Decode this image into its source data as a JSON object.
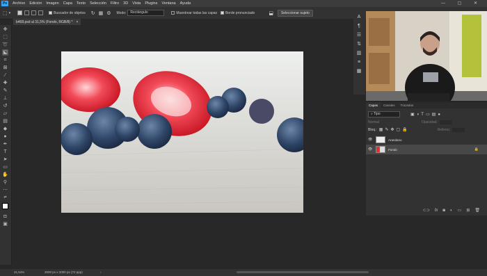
{
  "app": {
    "logo": "Ps"
  },
  "menu": [
    "Archivo",
    "Edición",
    "Imagen",
    "Capa",
    "Texto",
    "Selección",
    "Filtro",
    "3D",
    "Vista",
    "Plugins",
    "Ventana",
    "Ayuda"
  ],
  "window_controls": "—  ▢  ✕",
  "options": {
    "object_finder_label": "Buscador de objetos",
    "mode_label": "Modo:",
    "mode_value": "Rectángulo",
    "sample_all_layers": "Muestrear todas las capas",
    "hard_edge": "Borde pronunciado",
    "select_subject": "Seleccionar sujeto"
  },
  "document": {
    "tab_title": "b468.psd al 31,5% (Fondo, RGB/8) *",
    "close": "×"
  },
  "status": {
    "zoom": "31,54%",
    "dimensions": "3000 px x 2000 px (72 ppp)",
    "arrow": "›"
  },
  "layers_panel": {
    "tabs": [
      "Capas",
      "Canales",
      "Trazados"
    ],
    "filter_kind": "Tipo",
    "blend_mode": "Normal",
    "opacity_label": "Opacidad:",
    "lock_label": "Bloq.:",
    "fill_label": "Relleno:",
    "layers": [
      {
        "name": "Arandano",
        "active": false
      },
      {
        "name": "Fondo",
        "active": true
      }
    ],
    "footer_icons": [
      "link-icon",
      "fx-icon",
      "mask-icon",
      "adjustment-icon",
      "group-icon",
      "new-layer-icon",
      "trash-icon"
    ]
  },
  "colors": {
    "accent": "#31a8ff",
    "canvas_bg": "#282828",
    "panel_bg": "#323232"
  }
}
